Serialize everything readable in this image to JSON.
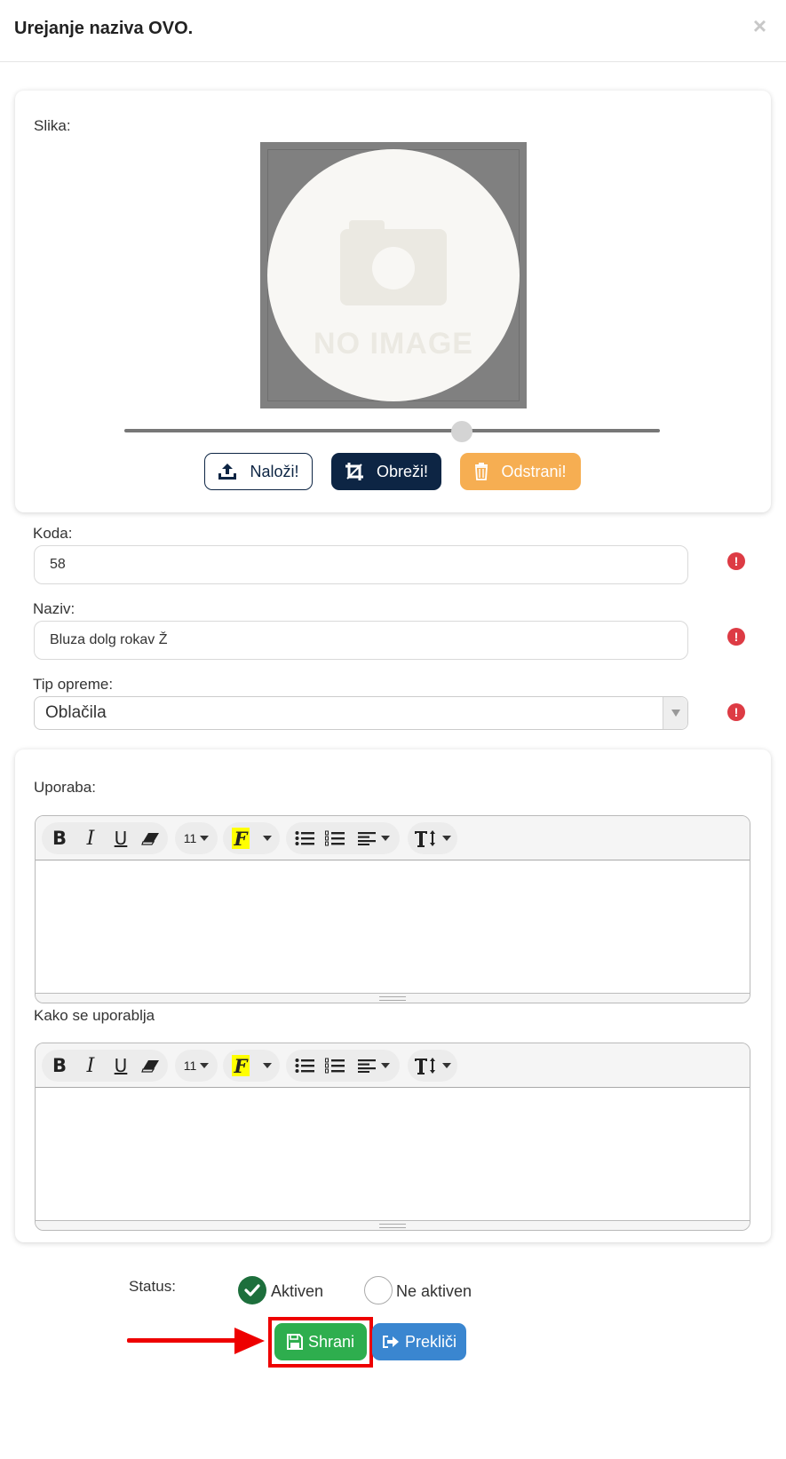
{
  "modal": {
    "title": "Urejanje naziva OVO.",
    "close_label": "×"
  },
  "image_section": {
    "label": "Slika:",
    "placeholder_text": "NO IMAGE",
    "buttons": {
      "upload": "Naloži!",
      "crop": "Obreži!",
      "remove": "Odstrani!"
    },
    "zoom_value": 0.63
  },
  "form": {
    "code": {
      "label": "Koda:",
      "value": "58"
    },
    "name": {
      "label": "Naziv:",
      "value": "Bluza dolg rokav Ž"
    },
    "type": {
      "label": "Tip opreme:",
      "selected": "Oblačila"
    },
    "required_icon": "!"
  },
  "editors": {
    "usage": {
      "label": "Uporaba:"
    },
    "how_to_use": {
      "label": "Kako se uporablja"
    },
    "toolbar": {
      "bold": "B",
      "italic": "I",
      "underline": "U",
      "font_size": "11",
      "font_family": "F"
    }
  },
  "status": {
    "label": "Status:",
    "active": "Aktiven",
    "inactive": "Ne aktiven",
    "selected": "Aktiven"
  },
  "actions": {
    "save": "Shrani",
    "cancel": "Prekliči"
  },
  "colors": {
    "navy": "#0d2544",
    "orange": "#f6ae52",
    "green": "#2eae4e",
    "blue": "#3a86d0",
    "danger": "#dd3b44",
    "annotation_red": "#ee0000"
  }
}
